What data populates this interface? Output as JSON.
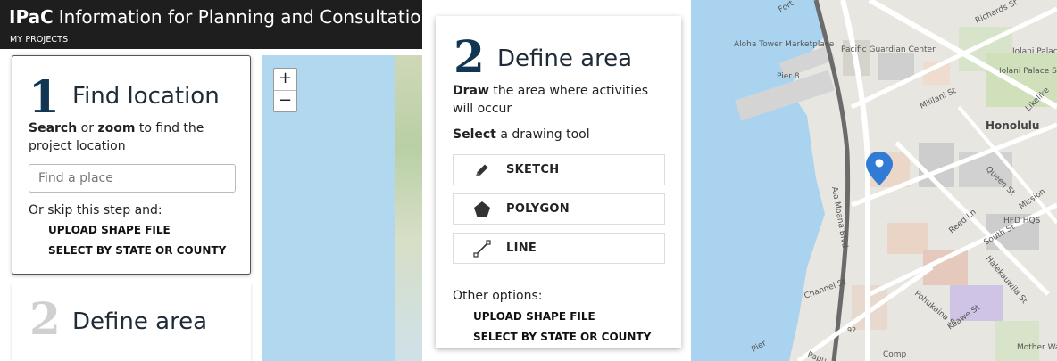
{
  "header": {
    "brand": "IPaC",
    "title": "Information for Planning and Consultation",
    "nav": "MY PROJECTS"
  },
  "map": {
    "zoom_in": "+",
    "zoom_out": "−"
  },
  "step1": {
    "number": "1",
    "title": "Find location",
    "instruction_prefix": "Search",
    "instruction_mid": " or ",
    "instruction_emph": "zoom",
    "instruction_suffix": " to find the project location",
    "search_placeholder": "Find a place",
    "skip_text": "Or skip this step and:",
    "upload_link": "UPLOAD SHAPE FILE",
    "state_link": "SELECT BY STATE OR COUNTY"
  },
  "step2": {
    "number": "2",
    "title": "Define area",
    "instruction_emph": "Draw",
    "instruction_suffix": " the area where activities will occur",
    "select_emph": "Select",
    "select_suffix": " a drawing tool",
    "tools": [
      {
        "label": "SKETCH",
        "icon": "pencil-icon"
      },
      {
        "label": "POLYGON",
        "icon": "polygon-icon"
      },
      {
        "label": "LINE",
        "icon": "line-icon"
      }
    ],
    "other_text": "Other options:",
    "upload_link": "UPLOAD SHAPE FILE",
    "state_link": "SELECT BY STATE OR COUNTY"
  },
  "street_map": {
    "labels": [
      "Aloha Tower Marketplace",
      "Pacific Guardian Center",
      "Pier 8",
      "Iolani Palace",
      "Iolani Palace State Monument",
      "Honolulu",
      "Mililani St",
      "Richards St",
      "Likelike",
      "Ala Moana Blvd",
      "Queen St",
      "HFD HQS",
      "Mission",
      "South St",
      "Reed Ln",
      "Halekauwila St",
      "Channel St",
      "Pohukaina St",
      "Keawe St",
      "Comp",
      "Mother Waldron",
      "Pier",
      "92",
      "Papu",
      "Fort"
    ]
  }
}
